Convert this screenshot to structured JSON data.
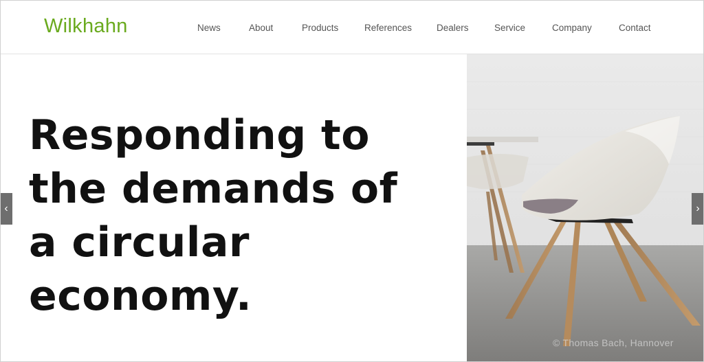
{
  "brand": {
    "name": "Wilkhahn",
    "color": "#6aaa1e"
  },
  "nav": {
    "items": [
      {
        "label": "News"
      },
      {
        "label": "About"
      },
      {
        "label": "Products"
      },
      {
        "label": "References"
      },
      {
        "label": "Dealers"
      },
      {
        "label": "Service"
      },
      {
        "label": "Company"
      },
      {
        "label": "Contact"
      }
    ]
  },
  "hero": {
    "headline_lines": [
      "Responding to",
      "the demands of",
      "a circular",
      "economy."
    ],
    "photo_credit": "© Thomas Bach, Hannover",
    "photo_subject": "white shell chair with oak wooden legs"
  },
  "slider": {
    "prev_icon": "chevron-left-icon",
    "next_icon": "chevron-right-icon"
  }
}
